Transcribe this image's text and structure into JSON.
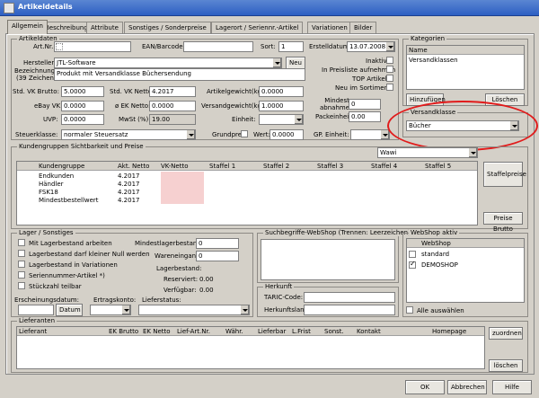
{
  "window": {
    "title": "Artikeldetails"
  },
  "tabs": [
    {
      "label": "Allgemein"
    },
    {
      "label": "Beschreibung"
    },
    {
      "label": "Attribute"
    },
    {
      "label": "Sonstiges / Sonderpreise"
    },
    {
      "label": "Lagerort / Seriennr.-Artikel"
    },
    {
      "label": "Variationen"
    },
    {
      "label": "Bilder"
    }
  ],
  "artikeldaten": {
    "legend": "Artikeldaten",
    "artnr_label": "Art.Nr.:",
    "ean_label": "EAN/Barcode:",
    "sort_label": "Sort:",
    "sort_value": "1",
    "erstelldatum_label": "Erstelldatum:",
    "erstelldatum_value": "13.07.2008",
    "hersteller_label": "Hersteller:",
    "hersteller_value": "JTL-Software",
    "neu_button": "Neu",
    "inaktiv_label": "Inaktiv",
    "preisliste_label": "In Preisliste aufnehmen",
    "topartikel_label": "TOP Artikel",
    "neu_sortiment_label": "Neu im Sortiment",
    "bezeichnung_label": "Bezeichnung:",
    "bezeichnung_hint": "(39 Zeichen)",
    "bezeichnung_value": "Produkt mit Versandklasse Büchersendung",
    "std_vk_brutto_label": "Std. VK Brutto:",
    "std_vk_brutto_value": "5.0000",
    "std_vk_netto_label": "Std. VK Netto:",
    "std_vk_netto_value": "4.2017",
    "artikelgewicht_label": "Artikelgewicht(kg):",
    "artikelgewicht_value": "0.0000",
    "ebay_vk_label": "eBay VK:",
    "ebay_vk_value": "0.0000",
    "ek_netto_label": "ø EK Netto:",
    "ek_netto_value": "0.0000",
    "versandgewicht_label": "Versandgewicht(kg):",
    "versandgewicht_value": "1.0000",
    "mindestabnahme_label": "Mindest-\nabnahme:",
    "mindestabnahme_value": "0",
    "uvp_label": "UVP:",
    "uvp_value": "0.0000",
    "mwst_label": "MwSt (%):",
    "mwst_value": "19.00",
    "einheit_label": "Einheit:",
    "packeinheit_label": "Packeinheit:",
    "packeinheit_value": "0.00",
    "steuerklasse_label": "Steuerklasse:",
    "steuerklasse_value": "normaler Steuersatz",
    "grundpreis_label": "Grundpreis",
    "wert_label": "Wert:",
    "wert_value": "0.0000",
    "gp_einheit_label": "GP. Einheit:"
  },
  "kategorien": {
    "legend": "Kategorien",
    "column": "Name",
    "items": [
      "Versandklassen"
    ],
    "add_button": "Hinzufügen",
    "delete_button": "Löschen"
  },
  "versandklasse": {
    "legend": "Versandklasse",
    "value": "Bücher"
  },
  "kundengruppen": {
    "legend": "Kundengruppen Sichtbarkeit und Preise",
    "wawi_select": "Wawi",
    "columns": [
      "Kundengruppe",
      "Akt. Netto",
      "VK-Netto",
      "Staffel 1",
      "Staffel 2",
      "Staffel 3",
      "Staffel 4",
      "Staffel 5"
    ],
    "rows": [
      {
        "name": "Endkunden",
        "netto": "4.2017"
      },
      {
        "name": "Händler",
        "netto": "4.2017"
      },
      {
        "name": "FSK18",
        "netto": "4.2017"
      },
      {
        "name": "Mindestbestellwert",
        "netto": "4.2017"
      }
    ],
    "staffelpreise_button": "Staffelpreise",
    "preise_brutto_button": "Preise Brutto"
  },
  "lager": {
    "legend": "Lager / Sonstiges",
    "checkboxes": [
      "Mit Lagerbestand arbeiten",
      "Lagerbestand darf kleiner Null werden",
      "Lagerbestand in Variationen",
      "Seriennummer-Artikel *)",
      "Stückzahl teilbar"
    ],
    "mindestlagerbestand_label": "Mindestlagerbestand:",
    "mindestlagerbestand_value": "0",
    "wareneingang_label": "Wareneingang:",
    "wareneingang_value": "0",
    "lagerbestand_label": "Lagerbestand:",
    "reserviert_label": "Reserviert:",
    "reserviert_value": "0.00",
    "verfuegbar_label": "Verfügbar:",
    "verfuegbar_value": "0.00",
    "erscheinungsdatum_label": "Erscheinungsdatum:",
    "datum_button": "Datum",
    "ertragskonto_label": "Ertragskonto:",
    "lieferstatus_label": "Lieferstatus:"
  },
  "suchbegriffe": {
    "legend": "Suchbegriffe-WebShop (Trennen: Leerzeichen)"
  },
  "herkunft": {
    "legend": "Herkunft",
    "taric_label": "TARIC-Code:",
    "herkunftsland_label": "Herkunftsland:"
  },
  "webshop": {
    "legend": "WebShop aktiv",
    "column": "WebShop",
    "items": [
      {
        "name": "standard",
        "checked": false
      },
      {
        "name": "DEMOSHOP",
        "checked": true
      }
    ],
    "alle_label": "Alle auswählen"
  },
  "lieferanten": {
    "legend": "Lieferanten",
    "columns": [
      "Lieferant",
      "EK Brutto",
      "EK Netto",
      "Lief-Art.Nr.",
      "Währ.",
      "Lieferbar",
      "L.Frist",
      "Sonst.",
      "Kontakt",
      "Homepage"
    ],
    "zuordnen_button": "zuordnen",
    "loeschen_button": "löschen"
  },
  "footer": {
    "ok": "OK",
    "abbrechen": "Abbrechen",
    "hilfe": "Hilfe"
  },
  "colors": {
    "title": "#2d5fc3",
    "highlight_cell": "#f6d0d0",
    "annotation": "#e11b1b"
  }
}
